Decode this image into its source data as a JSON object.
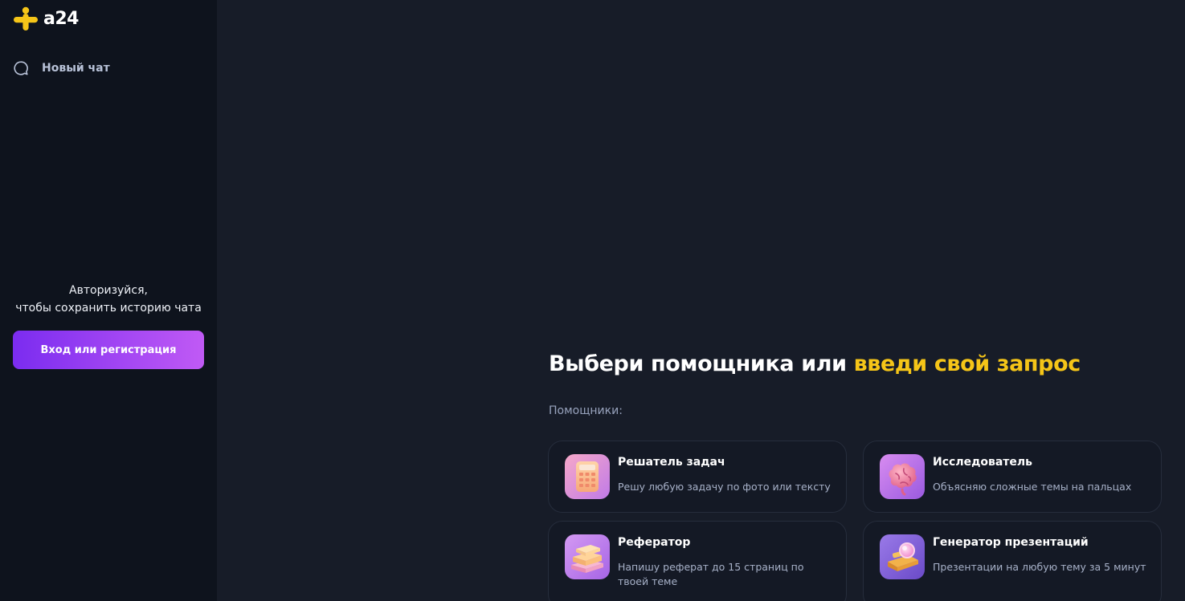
{
  "brand": {
    "name": "a24",
    "colors": {
      "logo_yellow": "#f5c518",
      "accent_yellow": "#f5c518",
      "button_gradient_start": "#7b2cf0",
      "button_gradient_end": "#c05af5"
    }
  },
  "sidebar": {
    "new_chat": {
      "icon": "chat-bubble-icon",
      "label": "Новый чат"
    },
    "auth_prompt": {
      "line1": "Авторизуйся,",
      "line2": "чтобы сохранить историю чата"
    },
    "auth_button": "Вход или регистрация"
  },
  "main": {
    "headline": {
      "part1": "Выбери помощника или ",
      "part2": "введи свой запрос"
    },
    "helpers_label": "Помощники:",
    "helpers": [
      {
        "title": "Решатель задач",
        "description": "Решу любую задачу по фото или тексту",
        "icon": "calculator-icon"
      },
      {
        "title": "Исследователь",
        "description": "Объясняю сложные темы на пальцах",
        "icon": "brain-icon"
      },
      {
        "title": "Реферат​ор",
        "description": "Напишу реферат до 15 страниц по твоей теме",
        "icon": "books-icon"
      },
      {
        "title": "Генератор презентаций",
        "description": "Презентации на любую тему за 5 минут",
        "icon": "presentation-icon"
      }
    ]
  }
}
